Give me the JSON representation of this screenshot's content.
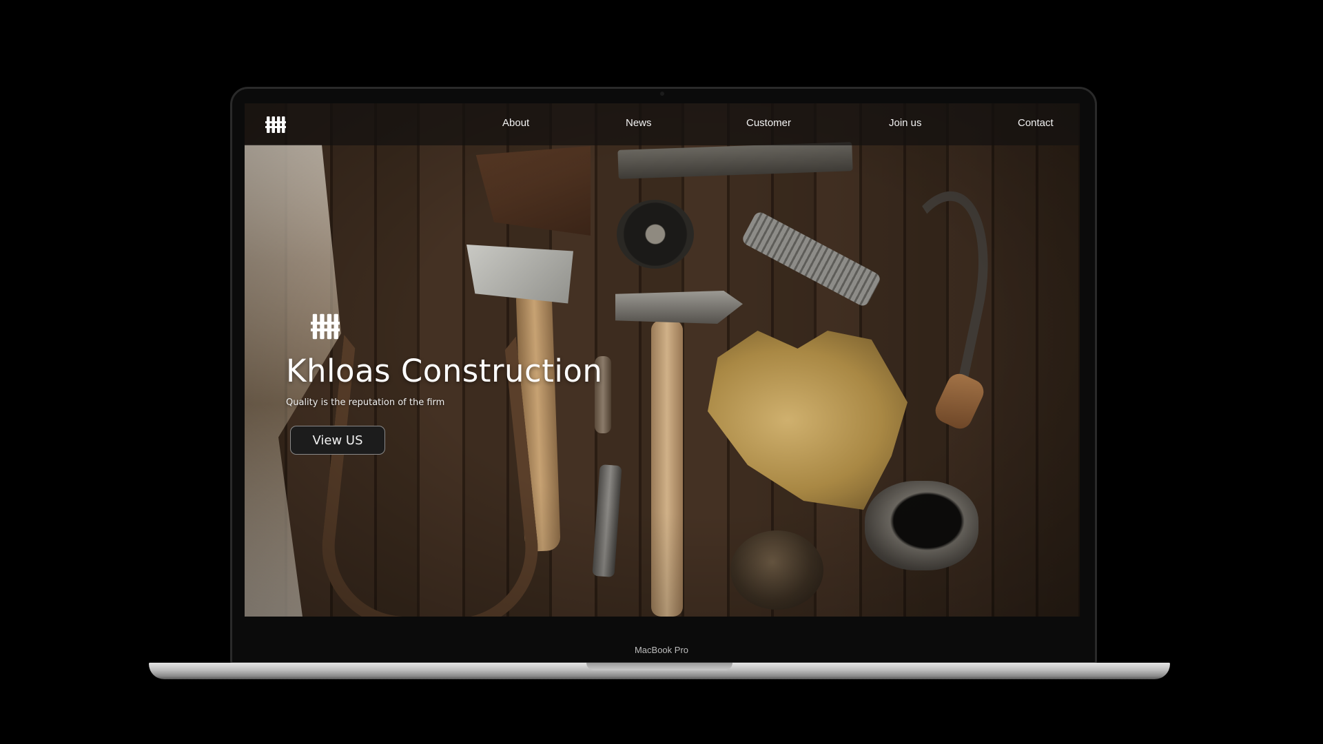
{
  "site": {
    "nav": {
      "about": "About",
      "news": "News",
      "customer": "Customer",
      "join": "Join us",
      "contact": "Contact"
    },
    "hero": {
      "title": "Khloas Construction",
      "subtitle": "Quality is the reputation of the firm",
      "button_label": "View US"
    },
    "logo_icon": "bars-logo-icon"
  },
  "device": {
    "label": "MacBook Pro"
  },
  "colors": {
    "background": "#000000",
    "header_overlay": "#14110f",
    "button_bg": "#1c1c1c",
    "text": "#ffffff"
  }
}
